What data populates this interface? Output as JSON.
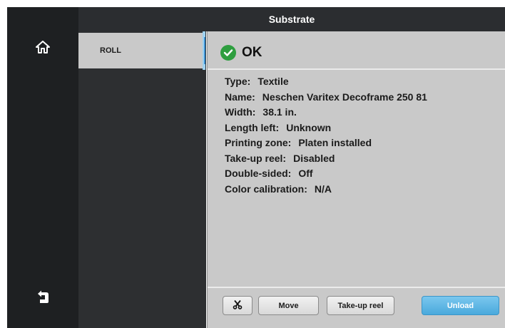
{
  "header": {
    "title": "Substrate"
  },
  "sidebar": {
    "home_icon": "home-icon",
    "back_icon": "back-icon"
  },
  "list": {
    "items": [
      {
        "label": "ROLL",
        "selected": true
      }
    ]
  },
  "detail": {
    "status": {
      "icon": "check-circle-icon",
      "text": "OK",
      "color": "#2e9e3f"
    },
    "properties": [
      {
        "key": "Type:",
        "value": "Textile"
      },
      {
        "key": "Name:",
        "value": "Neschen Varitex Decoframe 250 81"
      },
      {
        "key": "Width:",
        "value": "38.1 in."
      },
      {
        "key": "Length left:",
        "value": "Unknown"
      },
      {
        "key": "Printing zone:",
        "value": "Platen installed"
      },
      {
        "key": "Take-up reel:",
        "value": "Disabled"
      },
      {
        "key": "Double-sided:",
        "value": "Off"
      },
      {
        "key": "Color calibration:",
        "value": "N/A"
      }
    ]
  },
  "actions": {
    "cut_icon": "scissors-icon",
    "move_label": "Move",
    "takeup_label": "Take-up reel",
    "unload_label": "Unload",
    "unload_color": "#4aa9dc"
  }
}
